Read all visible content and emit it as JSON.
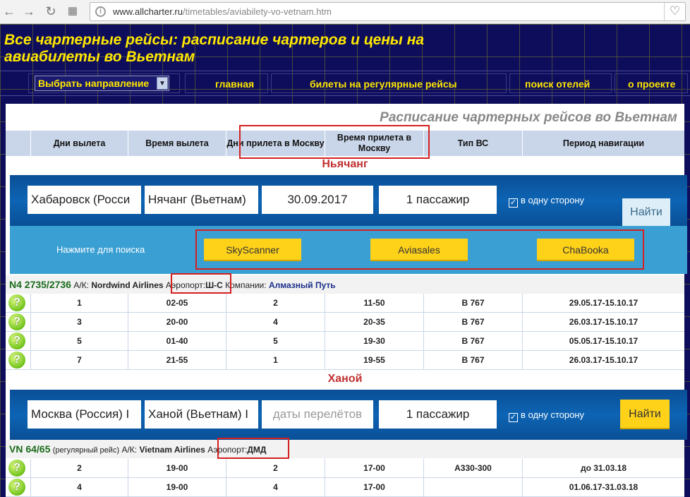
{
  "browser": {
    "url_host": "www.allcharter.ru",
    "url_path": "/timetables/aviabilety-vo-vetnam.htm",
    "back_icon": "back-arrow-icon",
    "forward_icon": "forward-arrow-icon",
    "reload_icon": "reload-icon",
    "apps_icon": "apps-grid-icon",
    "bookmark_icon": "heart-icon"
  },
  "site": {
    "title": "Все чартерные рейсы: расписание чартеров и цены на авиабилеты во Вьетнам",
    "nav": {
      "select_label": "Выбрать направление",
      "home": "главная",
      "regular": "билеты на регулярные рейсы",
      "hotels": "поиск отелей",
      "about": "о проекте"
    }
  },
  "panel": {
    "title": "Расписание чартерных рейсов во Вьетнам",
    "columns": [
      "Дни вылета",
      "Время вылета",
      "Дни прилета в Москву",
      "Время прилета в Москву",
      "Тип ВС",
      "Период навигации"
    ]
  },
  "sections": [
    {
      "city": "Ньячанг",
      "widget": {
        "from": "Хабаровск (Росси",
        "to": "Нячанг (Вьетнам)",
        "date": "30.09.2017",
        "passengers": "1 пассажир",
        "one_way": "в одну сторону",
        "find": "Найти",
        "press_label": "Нажмите для поиска",
        "buttons": [
          "SkyScanner",
          "Aviasales",
          "ChaBooka"
        ]
      },
      "flight": {
        "number": "N4 2735/2736",
        "airline_label": "А/К:",
        "airline": "Nordwind Airlines",
        "airport_label": "Аэропорт:",
        "airport": "Ш-С",
        "company_label": "Компании:",
        "company": "Алмазный Путь"
      },
      "rows": [
        [
          "1",
          "02-05",
          "2",
          "11-50",
          "B 767",
          "29.05.17-15.10.17"
        ],
        [
          "3",
          "20-00",
          "4",
          "20-35",
          "B 767",
          "26.03.17-15.10.17"
        ],
        [
          "5",
          "01-40",
          "5",
          "19-30",
          "B 767",
          "05.05.17-15.10.17"
        ],
        [
          "7",
          "21-55",
          "1",
          "19-55",
          "B 767",
          "26.03.17-15.10.17"
        ]
      ]
    },
    {
      "city": "Ханой",
      "widget": {
        "from": "Москва (Россия) I",
        "to": "Ханой (Вьетнам) I",
        "date_placeholder": "даты перелётов",
        "passengers": "1 пассажир",
        "one_way": "в одну сторону",
        "find": "Найти"
      },
      "flight": {
        "number": "VN 64/65",
        "note": "(регулярный рейс)",
        "airline_label": "А/К:",
        "airline": "Vietnam Airlines",
        "airport_label": "Аэропорт:",
        "airport": "ДМД"
      },
      "rows": [
        [
          "2",
          "19-00",
          "2",
          "17-00",
          "A330-300",
          "до 31.03.18"
        ],
        [
          "4",
          "19-00",
          "4",
          "17-00",
          "",
          "01.06.17-31.03.18"
        ]
      ]
    }
  ],
  "colors": {
    "site_bg": "#0d0d5b",
    "title_yellow": "#ffe800",
    "header_blue": "#c9d6ea",
    "widget_blue": "#0d64b4",
    "accent_yellow": "#ffd21a",
    "highlight_red": "#d42020",
    "city_red": "#c03030"
  }
}
